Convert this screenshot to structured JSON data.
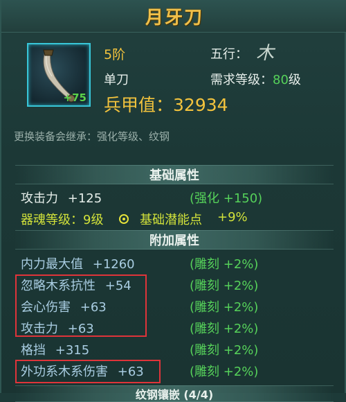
{
  "title": "月牙刀",
  "item": {
    "enhance": "+75",
    "tier": "5阶",
    "weapon_type": "单刀",
    "element_label": "五行：",
    "element_glyph": "木",
    "req_label": "需求等级：",
    "req_value": "80",
    "req_unit": "级",
    "power_label": "兵甲值：",
    "power_value": "32934"
  },
  "inherit_note": "更换装备会继承：强化等级、纹钢",
  "base_header": "基础属性",
  "base_attrs": [
    {
      "name": "攻击力",
      "value": "+125",
      "bonus": "(强化 +150)"
    }
  ],
  "soul_line": {
    "soul": "器魂等级：9级",
    "potential": "基础潜能点",
    "potential_value": "+9%"
  },
  "extra_header": "附加属性",
  "extra_attrs": [
    {
      "name": "内力最大值",
      "value": "+1260",
      "bonus": "(雕刻 +2%)"
    },
    {
      "name": "忽略木系抗性",
      "value": "+54",
      "bonus": "(雕刻 +2%)"
    },
    {
      "name": "会心伤害",
      "value": "+63",
      "bonus": "(雕刻 +2%)"
    },
    {
      "name": "攻击力",
      "value": "+63",
      "bonus": "(雕刻 +2%)"
    },
    {
      "name": "格挡",
      "value": "+315",
      "bonus": "(雕刻 +2%)"
    },
    {
      "name": "外功系木系伤害",
      "value": "+63",
      "bonus": "(雕刻 +2%)"
    }
  ],
  "inlay_header": "纹钢镶嵌 (4/4)",
  "colors": {
    "title": "#f0c04a",
    "highlight_box": "#e0343a",
    "bonus_green": "#56d25a"
  }
}
